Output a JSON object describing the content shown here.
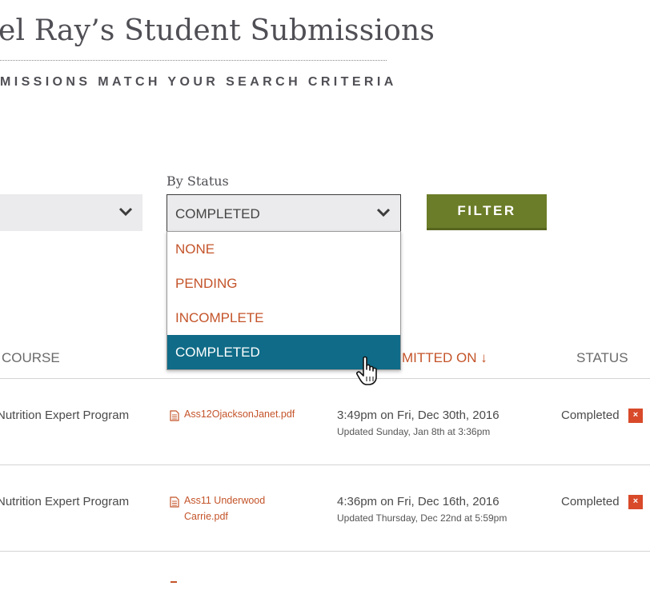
{
  "header": {
    "title": "el Ray’s Student Submissions",
    "subtitle": "MISSIONS MATCH YOUR SEARCH CRITERIA"
  },
  "filters": {
    "status_label": "By Status",
    "status_selected": "COMPLETED",
    "status_options": [
      "NONE",
      "PENDING",
      "INCOMPLETE",
      "COMPLETED"
    ],
    "filter_button": "FILTER"
  },
  "table": {
    "columns": {
      "course": "COURSE",
      "submitted": "MITTED ON ↓",
      "status": "STATUS"
    },
    "rows": [
      {
        "course": "Nutrition Expert Program",
        "file": "Ass12OjacksonJanet.pdf",
        "submitted": "3:49pm on Fri, Dec 30th, 2016",
        "updated": "Updated Sunday, Jan 8th at 3:36pm",
        "status": "Completed",
        "remove": "×"
      },
      {
        "course": "Nutrition Expert Program",
        "file": "Ass11 Underwood Carrie.pdf",
        "submitted": "4:36pm on Fri, Dec 16th, 2016",
        "updated": "Updated Thursday, Dec 22nd at 5:59pm",
        "status": "Completed",
        "remove": "×"
      }
    ]
  },
  "colors": {
    "accent": "#c4542a",
    "filter_button": "#6b7d28",
    "selected_option": "#0f6b87",
    "remove_badge": "#d84a2a"
  },
  "icons": [
    "chevron-down-icon",
    "file-icon",
    "hand-pointer-cursor-icon"
  ]
}
